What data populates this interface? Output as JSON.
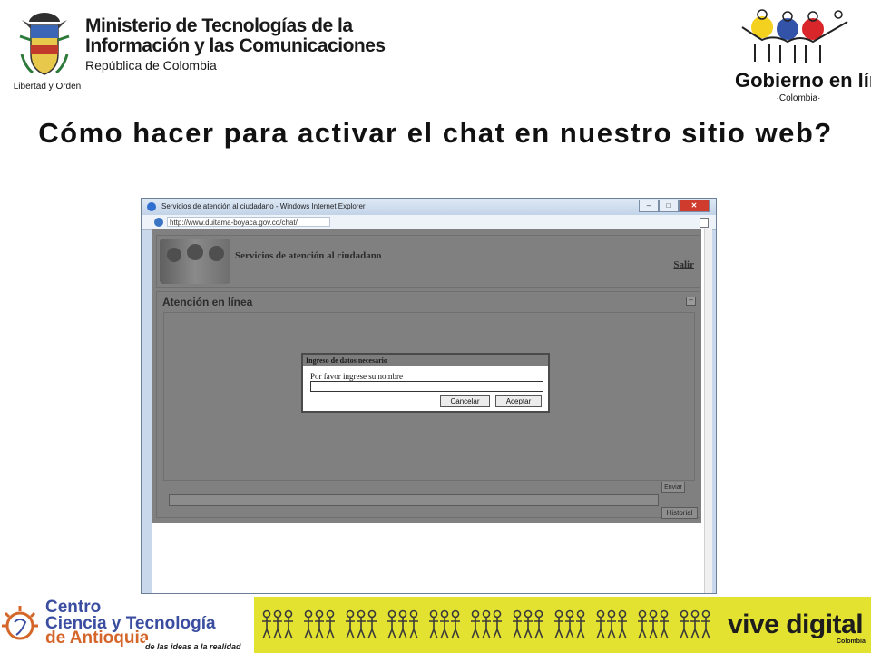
{
  "header": {
    "ministerio_line1": "Ministerio de Tecnologías de la",
    "ministerio_line2": "Información y las Comunicaciones",
    "ministerio_line3": "República de Colombia",
    "crest_caption": "Libertad y Orden",
    "gel_logo_text": "Gobierno en línea",
    "gel_logo_sub": "·Colombia·"
  },
  "slide": {
    "title": "Cómo hacer para activar el chat en nuestro sitio web?"
  },
  "browser": {
    "window_title": "Servicios de atención al ciudadano - Windows Internet Explorer",
    "url": "http://www.duitama-boyaca.gov.co/chat/",
    "min_icon": "minimize-icon",
    "max_icon": "maximize-icon",
    "close_icon": "close-icon"
  },
  "page": {
    "header_title": "Servicios de atención al ciudadano",
    "salir_label": "Salir",
    "chat_header": "Atención en línea",
    "collapse_label": "–",
    "enviar_label": "Enviar",
    "historial_label": "Historial",
    "message_value": ""
  },
  "dialog": {
    "title": "Ingreso de datos necesario",
    "label": "Por favor ingrese su nombre",
    "input_value": "",
    "cancel_label": "Cancelar",
    "accept_label": "Aceptar"
  },
  "footer": {
    "ccta_line1": "Centro",
    "ccta_de": "de",
    "ccta_line2": "Ciencia y Tecnología",
    "ccta_line3": "de Antioquia",
    "ccta_tagline": "de las ideas a la realidad",
    "vive_digital": "vive digital",
    "vive_sub": "Colombia"
  },
  "colors": {
    "title_text": "#111111",
    "overlay_gray": "#808080",
    "footer_yellow": "#e3e231",
    "ccta_blue": "#3a4da0",
    "ccta_orange": "#d4662a"
  }
}
